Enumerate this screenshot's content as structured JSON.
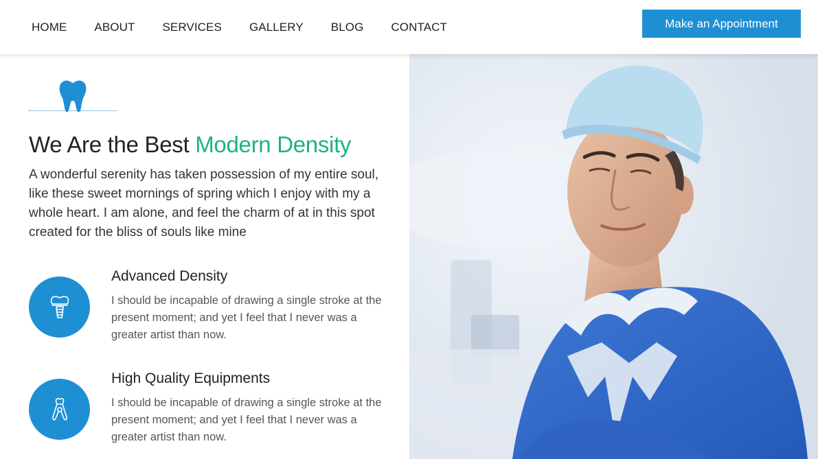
{
  "nav": {
    "items": [
      {
        "label": "HOME"
      },
      {
        "label": "ABOUT"
      },
      {
        "label": "SERVICES"
      },
      {
        "label": "GALLERY"
      },
      {
        "label": "BLOG"
      },
      {
        "label": "CONTACT"
      }
    ],
    "cta_label": "Make an Appointment"
  },
  "hero": {
    "headline_plain": "We Are the Best",
    "headline_accent": "Modern Density",
    "intro": "A wonderful serenity has taken possession of my entire soul, like these sweet mornings of spring which I enjoy with my a whole heart. I am alone, and feel the charm of at in this spot created for the bliss of souls like mine"
  },
  "features": [
    {
      "icon": "dental-implant-icon",
      "title": "Advanced Density",
      "desc": "I should be incapable of drawing a single stroke at the present moment; and yet I feel that I never was a greater artist than now."
    },
    {
      "icon": "dental-tool-icon",
      "title": "High Quality Equipments",
      "desc": "I should be incapable of drawing a single stroke at the present moment; and yet I feel that I never was a greater artist than now."
    }
  ],
  "colors": {
    "primary": "#1e8fd3",
    "accent": "#1db37a",
    "text": "#222222"
  }
}
